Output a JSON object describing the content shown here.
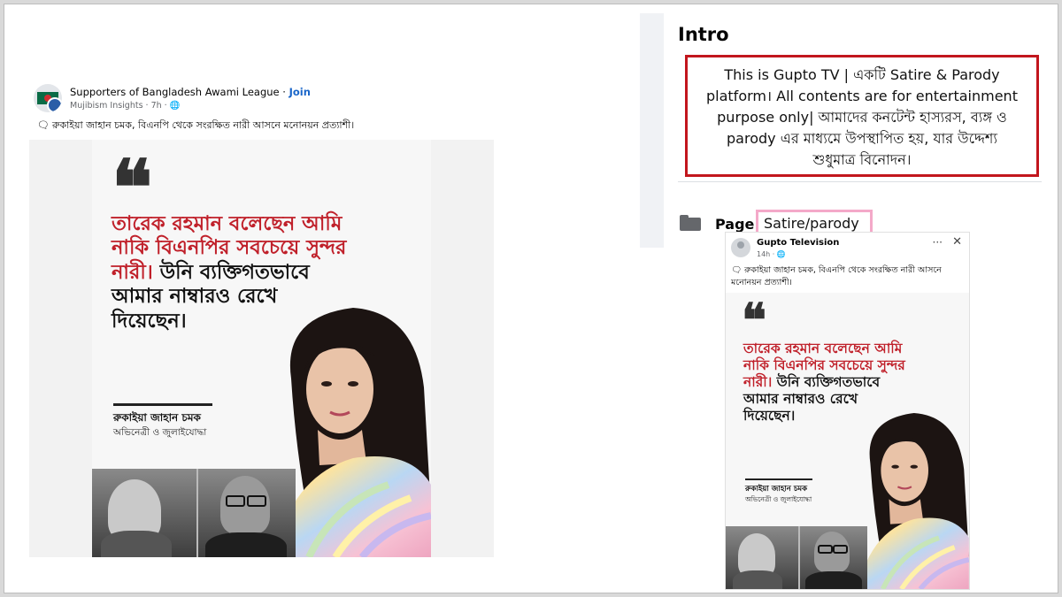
{
  "left_post": {
    "group_name": "Supporters of Bangladesh Awami League",
    "separator": " · ",
    "join_label": "Join",
    "sub_line": "Mujibism Insights · 7h · ",
    "globe_icon": "globe-icon",
    "caption": "রুকাইয়া জাহান চমক, বিএনপি থেকে সংরক্ষিত নারী আসনে মনোনয়ন প্রত্যাশী।"
  },
  "poster": {
    "quote_mark": "❝",
    "headline_red_1": "তারেক রহমান বলেছেন আমি",
    "headline_red_2": "নাকি বিএনপির সবচেয়ে সুন্দর",
    "headline_red_3": "নারী।",
    "headline_dark_3": " উনি ব্যক্তিগতভাবে",
    "headline_dark_4": "আমার নাম্বারও রেখে",
    "headline_dark_5": "দিয়েছেন।",
    "author": "রুকাইয়া জাহান চমক",
    "role": "অভিনেত্রী ও জুলাইযোদ্ধা"
  },
  "intro": {
    "title": "Intro",
    "bio_lines": [
      "This is Gupto TV | একটি Satire & Parody",
      "platform। All contents are for entertainment",
      "purpose only| আমাদের কনটেন্ট হাস্যরস, ব্যঙ্গ ও",
      "parody এর মাধ্যমে উপস্থাপিত হয়, যার উদ্দেশ্য",
      "শুধুমাত্র বিনোদন।"
    ],
    "page_label": "Page",
    "page_value": "Satire/parody"
  },
  "right_post": {
    "name": "Gupto Television",
    "time": "14h · ",
    "more_icon": "···",
    "close_icon": "✕",
    "caption": "রুকাইয়া জাহান চমক, বিএনপি থেকে সংরক্ষিত নারী আসনে মনোনয়ন প্রত্যাশী।"
  },
  "colors": {
    "frame_border": "#bdbdbd",
    "intro_highlight": "#c2161d",
    "page_highlight": "#f4a9c9",
    "join_link": "#1a66c9",
    "headline_red": "#c0202a"
  }
}
